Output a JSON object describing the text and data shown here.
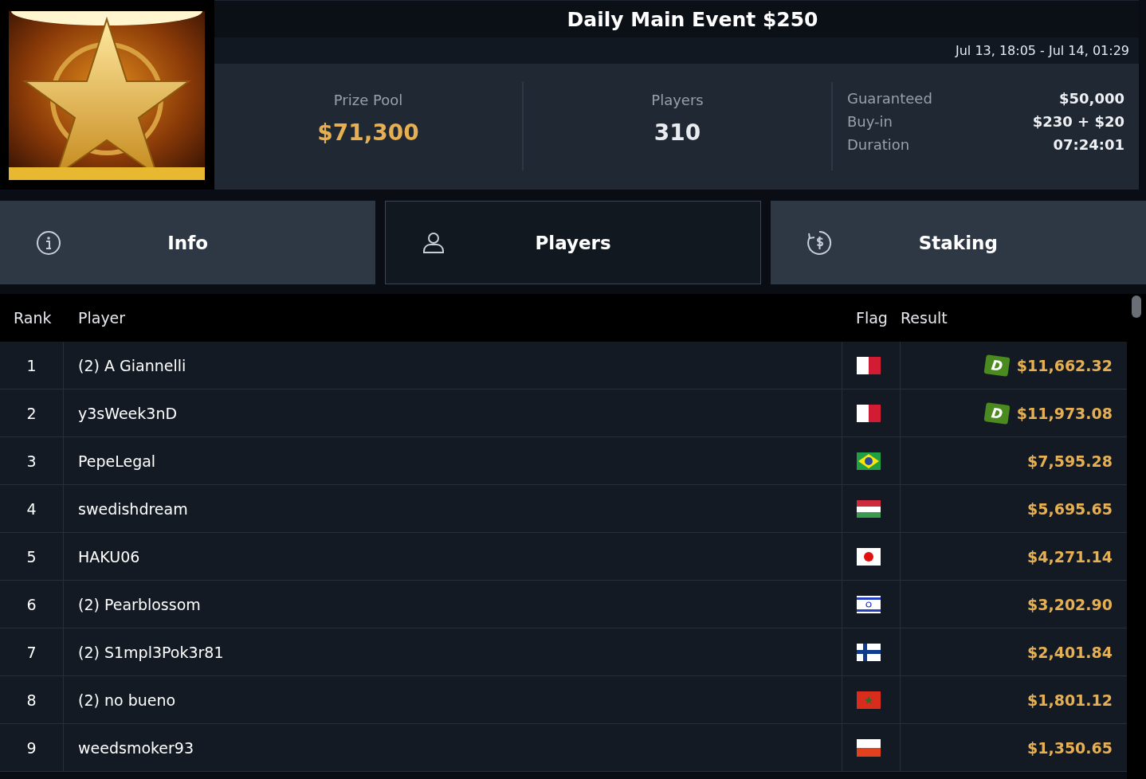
{
  "title": "Daily Main Event $250",
  "dates": "Jul 13, 18:05 - Jul 14, 01:29",
  "stats": [
    {
      "label": "Prize Pool",
      "value": "$71,300",
      "kind": "money"
    },
    {
      "label": "Players",
      "value": "310",
      "kind": "plain"
    }
  ],
  "details": [
    {
      "label": "Guaranteed",
      "value": "$50,000"
    },
    {
      "label": "Buy-in",
      "value": "$230 + $20"
    },
    {
      "label": "Duration",
      "value": "07:24:01"
    }
  ],
  "tabs": [
    {
      "label": "Info",
      "selected": false
    },
    {
      "label": "Players",
      "selected": true
    },
    {
      "label": "Staking",
      "selected": false
    }
  ],
  "table": {
    "columns": [
      "Rank",
      "Player",
      "Flag",
      "Result"
    ],
    "rows": [
      {
        "rank": "1",
        "player": "(2) A Giannelli",
        "badge": "D",
        "result": "$11,662.32"
      },
      {
        "rank": "2",
        "player": "y3sWeek3nD",
        "badge": "D",
        "result": "$11,973.08"
      },
      {
        "rank": "3",
        "player": "PepeLegal",
        "result": "$7,595.28"
      },
      {
        "rank": "4",
        "player": "swedishdream",
        "result": "$5,695.65"
      },
      {
        "rank": "5",
        "player": "HAKU06",
        "result": "$4,271.14"
      },
      {
        "rank": "6",
        "player": "(2) Pearblossom",
        "result": "$3,202.90"
      },
      {
        "rank": "7",
        "player": "(2) S1mpl3Pok3r81",
        "result": "$2,401.84"
      },
      {
        "rank": "8",
        "player": "(2) no bueno",
        "result": "$1,801.12"
      },
      {
        "rank": "9",
        "player": "weedsmoker93",
        "result": "$1,350.65"
      }
    ]
  }
}
